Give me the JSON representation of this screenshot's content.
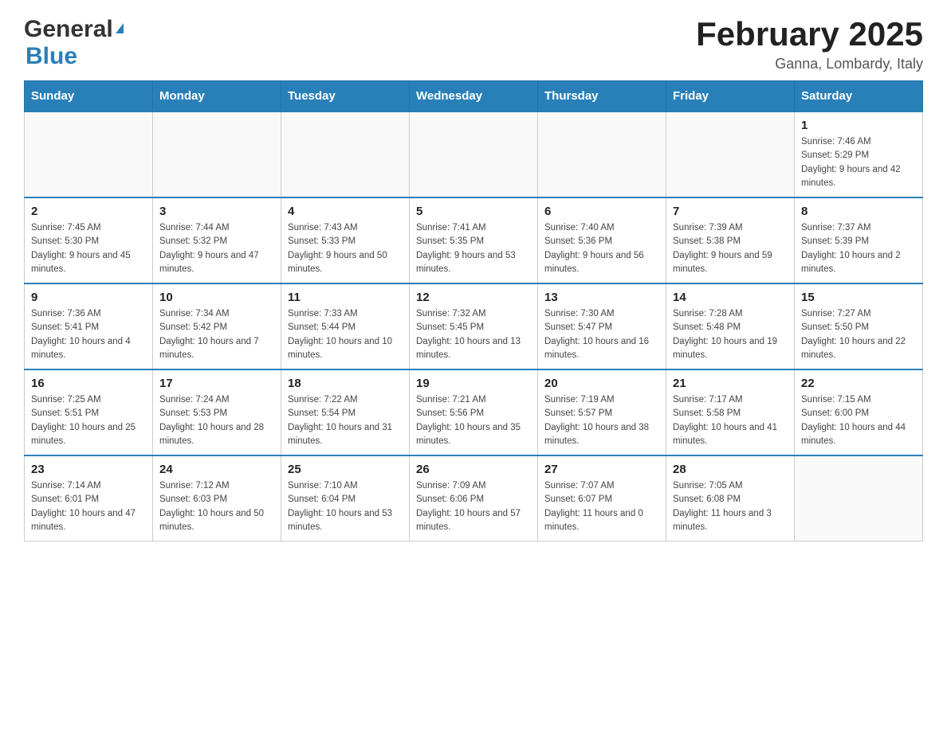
{
  "header": {
    "logo_general": "General",
    "logo_blue": "Blue",
    "month_title": "February 2025",
    "subtitle": "Ganna, Lombardy, Italy"
  },
  "days_of_week": [
    "Sunday",
    "Monday",
    "Tuesday",
    "Wednesday",
    "Thursday",
    "Friday",
    "Saturday"
  ],
  "weeks": [
    [
      {
        "day": "",
        "info": ""
      },
      {
        "day": "",
        "info": ""
      },
      {
        "day": "",
        "info": ""
      },
      {
        "day": "",
        "info": ""
      },
      {
        "day": "",
        "info": ""
      },
      {
        "day": "",
        "info": ""
      },
      {
        "day": "1",
        "info": "Sunrise: 7:46 AM\nSunset: 5:29 PM\nDaylight: 9 hours and 42 minutes."
      }
    ],
    [
      {
        "day": "2",
        "info": "Sunrise: 7:45 AM\nSunset: 5:30 PM\nDaylight: 9 hours and 45 minutes."
      },
      {
        "day": "3",
        "info": "Sunrise: 7:44 AM\nSunset: 5:32 PM\nDaylight: 9 hours and 47 minutes."
      },
      {
        "day": "4",
        "info": "Sunrise: 7:43 AM\nSunset: 5:33 PM\nDaylight: 9 hours and 50 minutes."
      },
      {
        "day": "5",
        "info": "Sunrise: 7:41 AM\nSunset: 5:35 PM\nDaylight: 9 hours and 53 minutes."
      },
      {
        "day": "6",
        "info": "Sunrise: 7:40 AM\nSunset: 5:36 PM\nDaylight: 9 hours and 56 minutes."
      },
      {
        "day": "7",
        "info": "Sunrise: 7:39 AM\nSunset: 5:38 PM\nDaylight: 9 hours and 59 minutes."
      },
      {
        "day": "8",
        "info": "Sunrise: 7:37 AM\nSunset: 5:39 PM\nDaylight: 10 hours and 2 minutes."
      }
    ],
    [
      {
        "day": "9",
        "info": "Sunrise: 7:36 AM\nSunset: 5:41 PM\nDaylight: 10 hours and 4 minutes."
      },
      {
        "day": "10",
        "info": "Sunrise: 7:34 AM\nSunset: 5:42 PM\nDaylight: 10 hours and 7 minutes."
      },
      {
        "day": "11",
        "info": "Sunrise: 7:33 AM\nSunset: 5:44 PM\nDaylight: 10 hours and 10 minutes."
      },
      {
        "day": "12",
        "info": "Sunrise: 7:32 AM\nSunset: 5:45 PM\nDaylight: 10 hours and 13 minutes."
      },
      {
        "day": "13",
        "info": "Sunrise: 7:30 AM\nSunset: 5:47 PM\nDaylight: 10 hours and 16 minutes."
      },
      {
        "day": "14",
        "info": "Sunrise: 7:28 AM\nSunset: 5:48 PM\nDaylight: 10 hours and 19 minutes."
      },
      {
        "day": "15",
        "info": "Sunrise: 7:27 AM\nSunset: 5:50 PM\nDaylight: 10 hours and 22 minutes."
      }
    ],
    [
      {
        "day": "16",
        "info": "Sunrise: 7:25 AM\nSunset: 5:51 PM\nDaylight: 10 hours and 25 minutes."
      },
      {
        "day": "17",
        "info": "Sunrise: 7:24 AM\nSunset: 5:53 PM\nDaylight: 10 hours and 28 minutes."
      },
      {
        "day": "18",
        "info": "Sunrise: 7:22 AM\nSunset: 5:54 PM\nDaylight: 10 hours and 31 minutes."
      },
      {
        "day": "19",
        "info": "Sunrise: 7:21 AM\nSunset: 5:56 PM\nDaylight: 10 hours and 35 minutes."
      },
      {
        "day": "20",
        "info": "Sunrise: 7:19 AM\nSunset: 5:57 PM\nDaylight: 10 hours and 38 minutes."
      },
      {
        "day": "21",
        "info": "Sunrise: 7:17 AM\nSunset: 5:58 PM\nDaylight: 10 hours and 41 minutes."
      },
      {
        "day": "22",
        "info": "Sunrise: 7:15 AM\nSunset: 6:00 PM\nDaylight: 10 hours and 44 minutes."
      }
    ],
    [
      {
        "day": "23",
        "info": "Sunrise: 7:14 AM\nSunset: 6:01 PM\nDaylight: 10 hours and 47 minutes."
      },
      {
        "day": "24",
        "info": "Sunrise: 7:12 AM\nSunset: 6:03 PM\nDaylight: 10 hours and 50 minutes."
      },
      {
        "day": "25",
        "info": "Sunrise: 7:10 AM\nSunset: 6:04 PM\nDaylight: 10 hours and 53 minutes."
      },
      {
        "day": "26",
        "info": "Sunrise: 7:09 AM\nSunset: 6:06 PM\nDaylight: 10 hours and 57 minutes."
      },
      {
        "day": "27",
        "info": "Sunrise: 7:07 AM\nSunset: 6:07 PM\nDaylight: 11 hours and 0 minutes."
      },
      {
        "day": "28",
        "info": "Sunrise: 7:05 AM\nSunset: 6:08 PM\nDaylight: 11 hours and 3 minutes."
      },
      {
        "day": "",
        "info": ""
      }
    ]
  ]
}
